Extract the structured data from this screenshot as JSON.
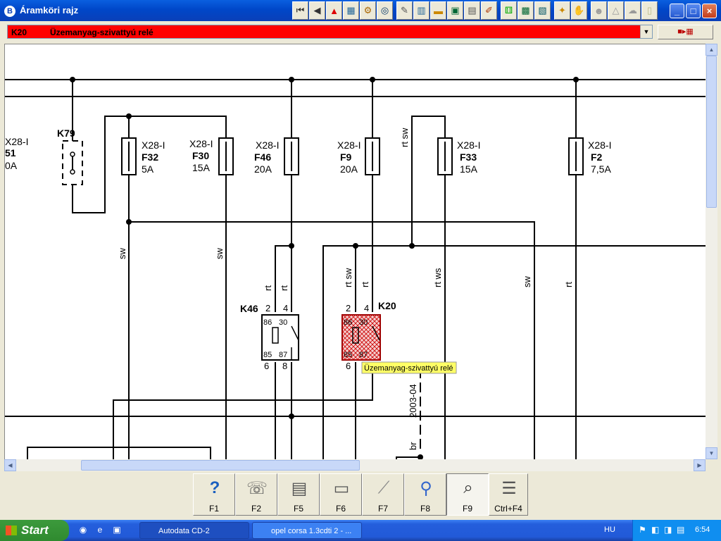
{
  "window": {
    "title": "Áramköri rajz"
  },
  "toolbar": [
    "first-icon",
    "back-icon",
    "warning-icon",
    "map-icon",
    "gear-icon",
    "wheel-icon",
    "tool-icon",
    "tape-icon",
    "sign-icon",
    "car-icon",
    "pen-icon",
    "wrench-icon",
    "lightbulb-icon",
    "box-icon",
    "bulb-icon",
    "bell-icon",
    "person-icon",
    "hand-icon",
    "cloud-icon",
    "doc-icon"
  ],
  "component": {
    "code": "K20",
    "name": "Üzemanyag-szivattyú relé",
    "color": "#ff0000"
  },
  "diagram": {
    "labels": {
      "k79": "K79",
      "x28_left": "X28-I",
      "left_51": "51",
      "left_0a": "0A",
      "f32_x": "X28-I",
      "f32": "F32",
      "f32_a": "5A",
      "f30_x": "X28-I",
      "f30": "F30",
      "f30_a": "15A",
      "f46_x": "X28-I",
      "f46": "F46",
      "f46_a": "20A",
      "f9_x": "X28-I",
      "f9": "F9",
      "f9_a": "20A",
      "f33_x": "X28-I",
      "f33": "F33",
      "f33_a": "15A",
      "f2_x": "X28-I",
      "f2": "F2",
      "f2_a": "7,5A",
      "rt_sw_top": "rt sw",
      "sw1": "sw",
      "sw2": "sw",
      "rt1": "rt",
      "rt2": "rt",
      "rt_sw2": "rt sw",
      "rt3": "rt",
      "rt_ws": "rt ws",
      "sw3": "sw",
      "rt4": "rt",
      "k46": "K46",
      "k46_2": "2",
      "k46_4": "4",
      "k46_86": "86",
      "k46_30": "30",
      "k46_85": "85",
      "k46_87": "87",
      "k46_6": "6",
      "k46_8": "8",
      "k20": "K20",
      "k20_2": "2",
      "k20_4": "4",
      "k20_86": "86",
      "k20_30": "30",
      "k20_85": "85",
      "k20_87": "87",
      "k20_6": "6",
      "tooltip": "Üzemanyag-szivattyú relé",
      "date": "2003-04",
      "br": "br"
    }
  },
  "fnkeys": [
    {
      "label": "F1",
      "icon": "help-icon"
    },
    {
      "label": "F2",
      "icon": "fax-icon"
    },
    {
      "label": "F5",
      "icon": "printer-icon"
    },
    {
      "label": "F6",
      "icon": "connector-icon"
    },
    {
      "label": "F7",
      "icon": "probe-icon"
    },
    {
      "label": "F8",
      "icon": "search-circuit-icon"
    },
    {
      "label": "F9",
      "icon": "magnifier-icon"
    },
    {
      "label": "Ctrl+F4",
      "icon": "list-icon"
    }
  ],
  "taskbar": {
    "start": "Start",
    "tasks": [
      "Autodata CD-2",
      "opel corsa 1.3cdti 2 - ..."
    ],
    "lang": "HU",
    "time": "6:54"
  }
}
